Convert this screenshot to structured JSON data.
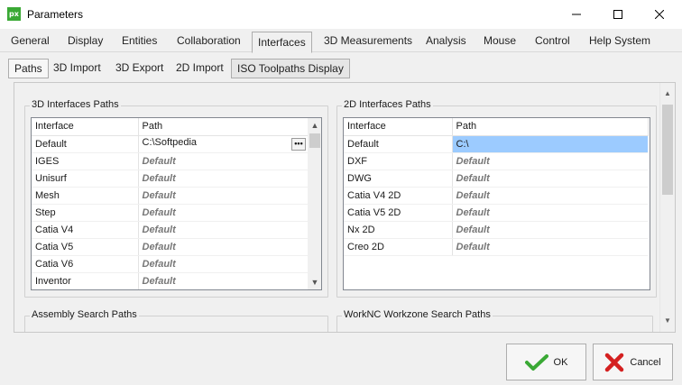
{
  "window": {
    "app_icon_text": "px",
    "title": "Parameters",
    "minimize_glyph": "—",
    "maximize_glyph": "☐",
    "close_glyph": "✕"
  },
  "main_tabs": [
    "General",
    "Display",
    "Entities",
    "Collaboration",
    "Interfaces",
    "3D Measurements",
    "Analysis",
    "Mouse",
    "Control",
    "Help System"
  ],
  "main_tab_active": "Interfaces",
  "sub_tabs": [
    "Paths",
    "3D Import",
    "3D Export",
    "2D Import",
    "ISO Toolpaths Display"
  ],
  "sub_tab_active": "Paths",
  "groups": {
    "interfaces_3d": {
      "title": "3D Interfaces Paths",
      "columns": [
        "Interface",
        "Path"
      ],
      "rows": [
        {
          "interface": "Default",
          "path": "C:\\Softpedia"
        },
        {
          "interface": "IGES",
          "path": "Default"
        },
        {
          "interface": "Unisurf",
          "path": "Default"
        },
        {
          "interface": "Mesh",
          "path": "Default"
        },
        {
          "interface": "Step",
          "path": "Default"
        },
        {
          "interface": "Catia V4",
          "path": "Default"
        },
        {
          "interface": "Catia V5",
          "path": "Default"
        },
        {
          "interface": "Catia V6",
          "path": "Default"
        },
        {
          "interface": "Inventor",
          "path": "Default"
        }
      ],
      "browse_button": "•••"
    },
    "interfaces_2d": {
      "title": "2D Interfaces Paths",
      "columns": [
        "Interface",
        "Path"
      ],
      "rows": [
        {
          "interface": "Default",
          "path": "C:\\"
        },
        {
          "interface": "DXF",
          "path": "Default"
        },
        {
          "interface": "DWG",
          "path": "Default"
        },
        {
          "interface": "Catia V4 2D",
          "path": "Default"
        },
        {
          "interface": "Catia V5 2D",
          "path": "Default"
        },
        {
          "interface": "Nx 2D",
          "path": "Default"
        },
        {
          "interface": "Creo 2D",
          "path": "Default"
        }
      ]
    },
    "assembly": {
      "title": "Assembly Search Paths"
    },
    "workzone": {
      "title": "WorkNC Workzone Search Paths"
    }
  },
  "footer": {
    "ok_label": "OK",
    "cancel_label": "Cancel"
  },
  "colors": {
    "selection": "#9ccbff",
    "ok_check": "#3aa935",
    "cancel_x": "#d42020",
    "app_icon": "#3aa935"
  }
}
